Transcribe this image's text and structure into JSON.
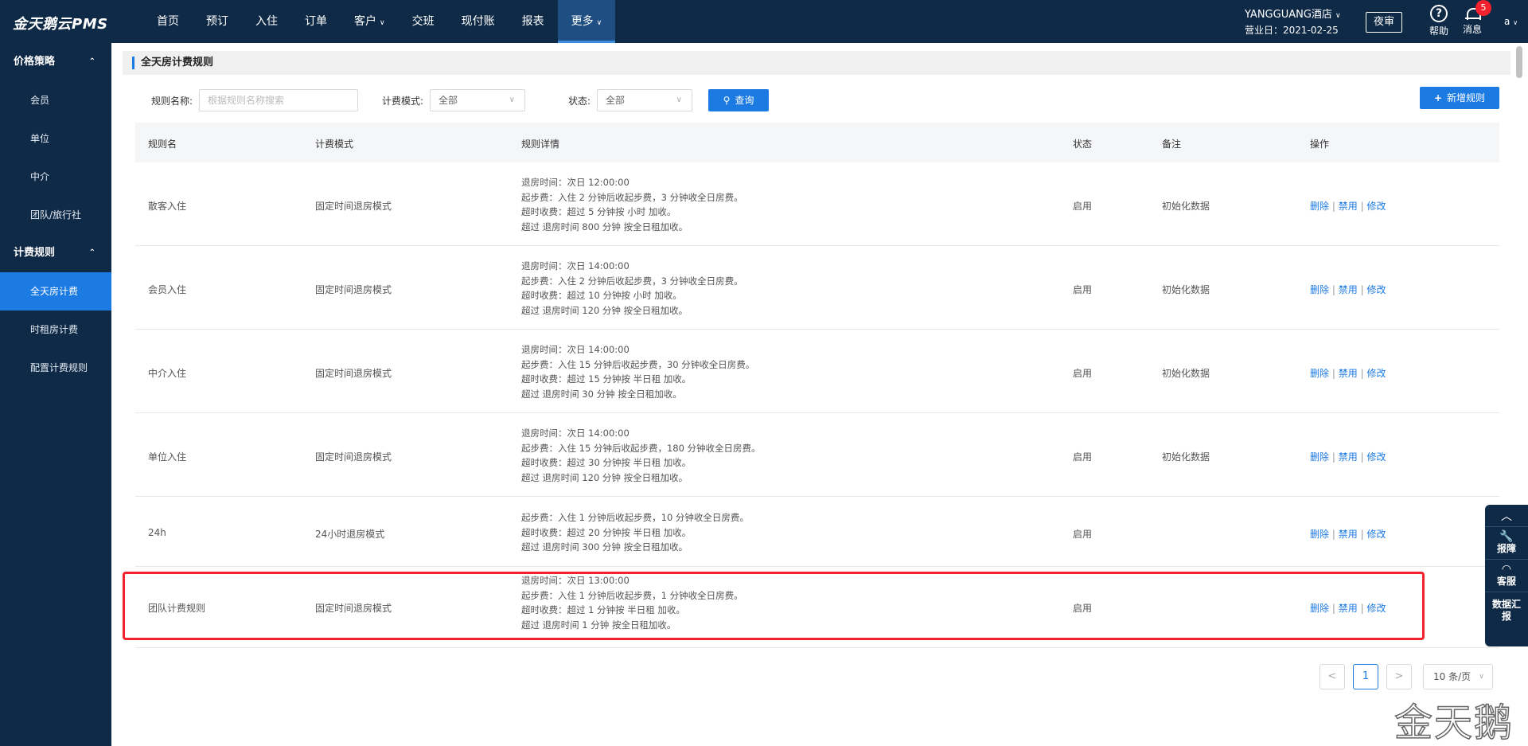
{
  "app": {
    "logo": "金天鹅云PMS"
  },
  "nav": {
    "items": [
      {
        "label": "首页",
        "chev": ""
      },
      {
        "label": "预订",
        "chev": ""
      },
      {
        "label": "入住",
        "chev": ""
      },
      {
        "label": "订单",
        "chev": ""
      },
      {
        "label": "客户",
        "chev": "∨"
      },
      {
        "label": "交班",
        "chev": ""
      },
      {
        "label": "现付账",
        "chev": ""
      },
      {
        "label": "报表",
        "chev": ""
      },
      {
        "label": "更多",
        "chev": "∨"
      }
    ],
    "active": "更多"
  },
  "header": {
    "hotel_name": "YANGGUANG酒店",
    "hotel_chev": "∨",
    "business_date": "营业日：2021-02-25",
    "night_audit": "夜审",
    "help_label": "帮助",
    "help_symbol": "?",
    "message_label": "消息",
    "message_count": "5",
    "user": "a",
    "user_chev": "∨"
  },
  "sidebar": {
    "group1": {
      "label": "价格策略",
      "caret": "⌃"
    },
    "group1_items": [
      "会员",
      "单位",
      "中介",
      "团队/旅行社"
    ],
    "group2": {
      "label": "计费规则",
      "caret": "⌃"
    },
    "group2_items": [
      "全天房计费",
      "时租房计费",
      "配置计费规则"
    ],
    "active": "全天房计费"
  },
  "page": {
    "title": "全天房计费规则"
  },
  "filters": {
    "rule_name_label": "规则名称:",
    "rule_name_placeholder": "根据规则名称搜索",
    "mode_label": "计费模式:",
    "mode_value": "全部",
    "status_label": "状态:",
    "status_value": "全部",
    "chev": "∨",
    "query_icon": "⚲",
    "query_button": "查询",
    "add_icon": "+",
    "add_button": "新增规则"
  },
  "table": {
    "columns": [
      "规则名",
      "计费模式",
      "规则详情",
      "状态",
      "备注",
      "操作"
    ],
    "ops": {
      "delete": "删除",
      "disable": "禁用",
      "edit": "修改",
      "sep": "|"
    },
    "rows": [
      {
        "name": "散客入住",
        "mode": "固定时间退房模式",
        "status": "启用",
        "note": "初始化数据",
        "details": [
          "退房时间：次日 12:00:00",
          "起步费：入住 2 分钟后收起步费，3 分钟收全日房费。",
          "超时收费：超过 5 分钟按 小时 加收。",
          "超过 退房时间 800 分钟 按全日租加收。"
        ]
      },
      {
        "name": "会员入住",
        "mode": "固定时间退房模式",
        "status": "启用",
        "note": "初始化数据",
        "details": [
          "退房时间：次日 14:00:00",
          "起步费：入住 2 分钟后收起步费，3 分钟收全日房费。",
          "超时收费：超过 10 分钟按 小时 加收。",
          "超过 退房时间 120 分钟 按全日租加收。"
        ]
      },
      {
        "name": "中介入住",
        "mode": "固定时间退房模式",
        "status": "启用",
        "note": "初始化数据",
        "details": [
          "退房时间：次日 14:00:00",
          "起步费：入住 15 分钟后收起步费，30 分钟收全日房费。",
          "超时收费：超过 15 分钟按 半日租 加收。",
          "超过 退房时间 30 分钟 按全日租加收。"
        ]
      },
      {
        "name": "单位入住",
        "mode": "固定时间退房模式",
        "status": "启用",
        "note": "初始化数据",
        "details": [
          "退房时间：次日 14:00:00",
          "起步费：入住 15 分钟后收起步费，180 分钟收全日房费。",
          "超时收费：超过 30 分钟按 半日租 加收。",
          "超过 退房时间 120 分钟 按全日租加收。"
        ]
      },
      {
        "name": "24h",
        "mode": "24小时退房模式",
        "status": "启用",
        "note": "",
        "details": [
          "起步费：入住 1 分钟后收起步费，10 分钟收全日房费。",
          "超时收费：超过 20 分钟按 半日租 加收。",
          "超过 退房时间 300 分钟 按全日租加收。"
        ]
      },
      {
        "name": "团队计费规则",
        "mode": "固定时间退房模式",
        "status": "启用",
        "note": "",
        "details": [
          "退房时间：次日 13:00:00",
          "起步费：入住 1 分钟后收起步费，1 分钟收全日房费。",
          "超时收费：超过 1 分钟按 半日租 加收。",
          "超过 退房时间 1 分钟 按全日租加收。"
        ]
      }
    ]
  },
  "pagination": {
    "prev": "<",
    "page": "1",
    "next": ">",
    "page_size": "10 条/页",
    "chev": "∨"
  },
  "float_panel": {
    "up": "︿",
    "items": [
      {
        "symbol": "🔧",
        "label": "报障"
      },
      {
        "symbol": "◠",
        "label": "客服"
      },
      {
        "symbol": "",
        "label": "数据汇报"
      }
    ]
  },
  "watermark": "金天鹅",
  "colors": {
    "nav_bg": "#0f2a47",
    "accent": "#1c7ae3",
    "highlight": "#f5222d"
  }
}
